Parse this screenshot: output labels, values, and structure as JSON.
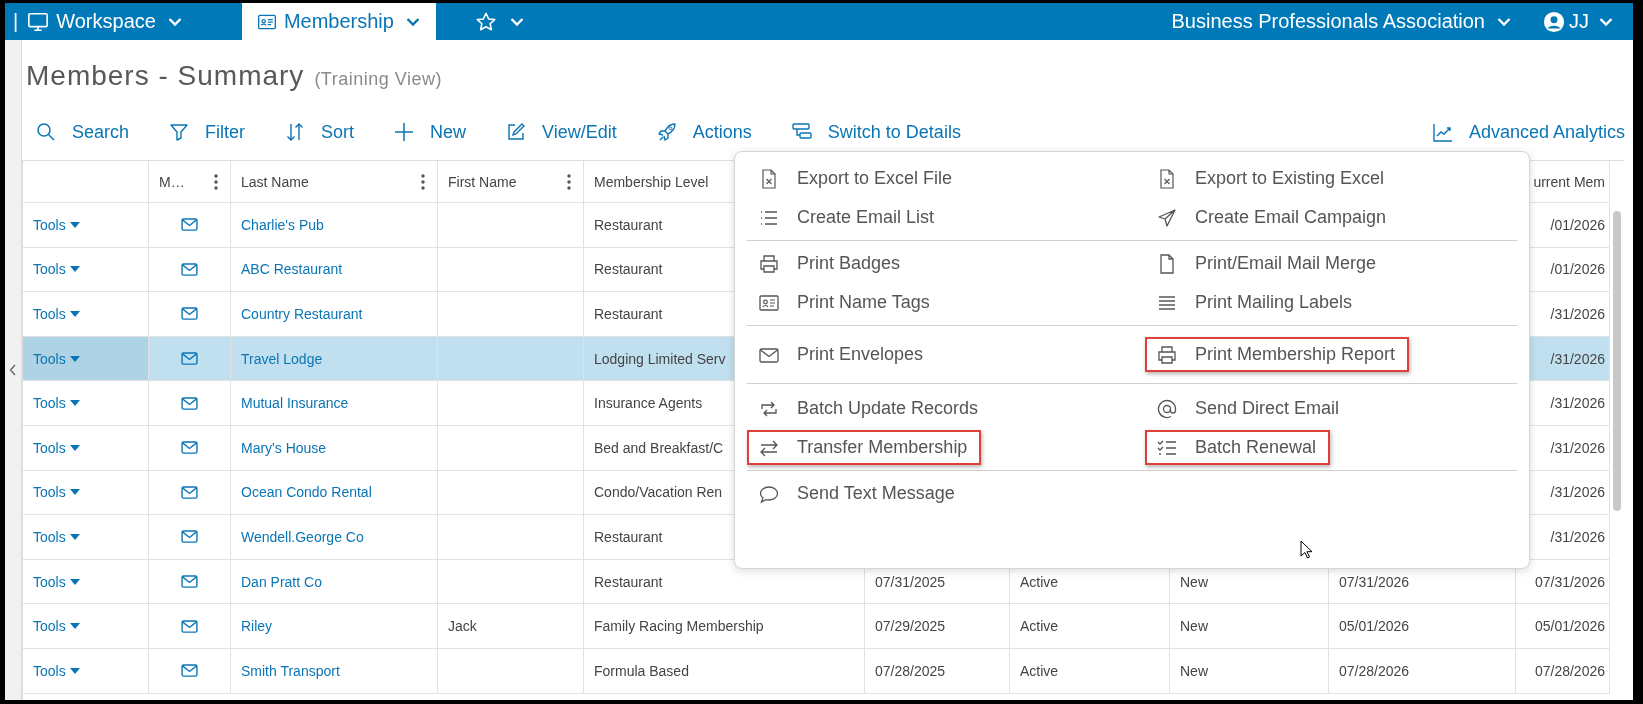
{
  "top_bar": {
    "leading_mark": "|",
    "menus": [
      {
        "kind": "workspace",
        "label": "Workspace",
        "selected": false
      },
      {
        "kind": "membership",
        "label": "Membership",
        "selected": true
      },
      {
        "kind": "favorites",
        "selected": false
      }
    ],
    "organization": "Business Professionals Association",
    "user": "JJ"
  },
  "page": {
    "title": "Members - Summary",
    "subtitle": "(Training View)"
  },
  "toolbar": {
    "actions": [
      {
        "kind": "search",
        "label": "Search"
      },
      {
        "kind": "filter",
        "label": "Filter"
      },
      {
        "kind": "sort",
        "label": "Sort"
      },
      {
        "kind": "new",
        "label": "New"
      },
      {
        "kind": "edit",
        "label": "View/Edit"
      },
      {
        "kind": "actions",
        "label": "Actions"
      },
      {
        "kind": "switch",
        "label": "Switch to Details"
      }
    ],
    "analytics": "Advanced Analytics"
  },
  "table": {
    "columns": [
      {},
      {
        "label": "M…",
        "has_menu": true
      },
      {
        "label": "Last Name",
        "has_menu": true
      },
      {
        "label": "First Name",
        "has_menu": true
      },
      {
        "label": "Membership Level"
      },
      {},
      {},
      {},
      {},
      {
        "label": "urrent Mem"
      }
    ],
    "rows": [
      {
        "tools": "Tools",
        "last_name": "Charlie's Pub",
        "membership_level": "Restaurant",
        "column_10": "/01/2026",
        "selected": false
      },
      {
        "tools": "Tools",
        "last_name": "ABC Restaurant",
        "membership_level": "Restaurant",
        "column_10": "/01/2026",
        "selected": false
      },
      {
        "tools": "Tools",
        "last_name": "Country Restaurant",
        "membership_level": "Restaurant",
        "column_10": "/31/2026",
        "selected": false
      },
      {
        "tools": "Tools",
        "last_name": "Travel Lodge",
        "membership_level": "Lodging Limited Serv",
        "column_10": "/31/2026",
        "selected": true
      },
      {
        "tools": "Tools",
        "last_name": "Mutual Insurance",
        "membership_level": "Insurance Agents",
        "column_10": "/31/2026",
        "selected": false
      },
      {
        "tools": "Tools",
        "last_name": "Mary's House",
        "membership_level": "Bed and Breakfast/C",
        "column_10": "/31/2026",
        "selected": false
      },
      {
        "tools": "Tools",
        "last_name": "Ocean Condo Rental",
        "membership_level": "Condo/Vacation Ren",
        "column_10": "/31/2026",
        "selected": false
      },
      {
        "tools": "Tools",
        "last_name": "Wendell.George Co",
        "membership_level": "Restaurant",
        "column_10": "/31/2026",
        "selected": false
      },
      {
        "tools": "Tools",
        "last_name": "Dan Pratt Co",
        "membership_level": "Restaurant",
        "column_6": "07/31/2025",
        "column_7": "Active",
        "column_8": "New",
        "column_9": "07/31/2026",
        "column_10": "07/31/2026",
        "selected": false
      },
      {
        "tools": "Tools",
        "last_name": "Riley",
        "first_name": "Jack",
        "membership_level": "Family Racing Membership",
        "column_6": "07/29/2025",
        "column_7": "Active",
        "column_8": "New",
        "column_9": "05/01/2026",
        "column_10": "05/01/2026",
        "selected": false
      },
      {
        "tools": "Tools",
        "last_name": "Smith Transport",
        "membership_level": "Formula Based",
        "column_6": "07/28/2025",
        "column_7": "Active",
        "column_8": "New",
        "column_9": "07/28/2026",
        "column_10": "07/28/2026",
        "selected": false
      }
    ]
  },
  "actions_menu": {
    "groups": [
      {
        "items": [
          {
            "kind": "excel",
            "label": "Export to Excel File",
            "highlighted": false
          },
          {
            "kind": "excel",
            "label": "Export to Existing Excel",
            "highlighted": false
          },
          {
            "kind": "list",
            "label": "Create Email List",
            "highlighted": false
          },
          {
            "kind": "send",
            "label": "Create Email Campaign",
            "highlighted": false
          }
        ]
      },
      {
        "items": [
          {
            "kind": "print",
            "label": "Print Badges",
            "highlighted": false
          },
          {
            "kind": "doc",
            "label": "Print/Email Mail Merge",
            "highlighted": false
          },
          {
            "kind": "card",
            "label": "Print Name Tags",
            "highlighted": false
          },
          {
            "kind": "lines",
            "label": "Print Mailing Labels",
            "highlighted": false
          }
        ]
      },
      {
        "items": [
          {
            "kind": "mail",
            "label": "Print Envelopes",
            "highlighted": false
          },
          {
            "kind": "print",
            "label": "Print Membership Report",
            "highlighted": true
          }
        ]
      },
      {
        "items": [
          {
            "kind": "cycle",
            "label": "Batch Update Records",
            "highlighted": false
          },
          {
            "kind": "at",
            "label": "Send Direct Email",
            "highlighted": false
          },
          {
            "kind": "transfer",
            "label": "Transfer Membership",
            "highlighted": true
          },
          {
            "kind": "checklist",
            "label": "Batch Renewal",
            "highlighted": true
          }
        ]
      },
      {
        "items": [
          {
            "kind": "chat",
            "label": "Send Text Message",
            "highlighted": false
          }
        ]
      }
    ]
  }
}
